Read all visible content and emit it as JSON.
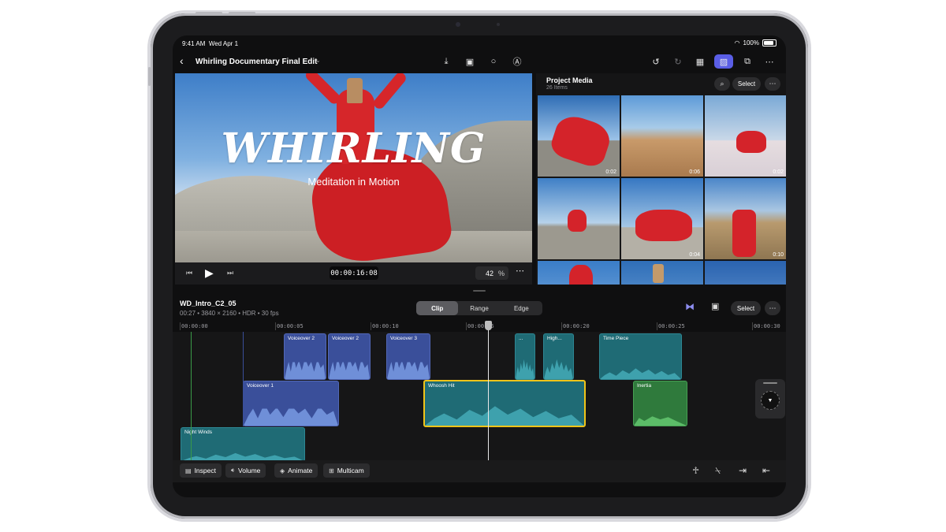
{
  "status": {
    "time": "9:41 AM",
    "date": "Wed Apr 1",
    "battery": "100%"
  },
  "toolbar": {
    "title": "Whirling Documentary Final Edit",
    "center_icons": [
      "import-icon",
      "camera-icon",
      "microphone-icon",
      "pencil-icon"
    ],
    "right_icons": [
      "undo-icon",
      "redo-icon",
      "inspector-icon",
      "media-browser-icon",
      "multicam-icon",
      "more-icon"
    ]
  },
  "viewer": {
    "title": "WHIRLING",
    "subtitle": "Meditation in Motion",
    "timecode": "00:00:16:08",
    "zoom_value": "42",
    "zoom_unit": "%"
  },
  "media": {
    "title": "Project Media",
    "count": "26 Items",
    "select_label": "Select",
    "thumbs": [
      {
        "duration": "0:02"
      },
      {
        "duration": "0:06"
      },
      {
        "duration": "0:02"
      },
      {
        "duration": ""
      },
      {
        "duration": "0:04"
      },
      {
        "duration": "0:10"
      },
      {
        "duration": ""
      },
      {
        "duration": ""
      },
      {
        "duration": ""
      }
    ]
  },
  "timeline": {
    "clip_name": "WD_Intro_C2_05",
    "clip_meta": "00:27 • 3840 × 2160 • HDR • 30 fps",
    "segments": [
      "Clip",
      "Range",
      "Edge"
    ],
    "active_segment": "Clip",
    "select_label": "Select",
    "ruler": [
      "00:00:00",
      "00:00:05",
      "00:00:10",
      "00:00:15",
      "00:00:20",
      "00:00:25",
      "00:00:30"
    ],
    "clips": {
      "vo2a": "Voiceover 2",
      "vo2b": "Voiceover 2",
      "vo3": "Voiceover 3",
      "small": "...",
      "high": "High...",
      "timepiece": "Time Piece",
      "vo1": "Voiceover 1",
      "whoosh": "Whoosh Hit",
      "inertia": "Inertia",
      "nightwinds": "Night Winds"
    }
  },
  "bottom": {
    "inspect": "Inspect",
    "volume": "Volume",
    "animate": "Animate",
    "multicam": "Multicam"
  },
  "colors": {
    "accent": "#5a5ee6",
    "voiceover": "#3a4f9a",
    "sfx": "#1f6b75",
    "music": "#2f7a3c",
    "selection": "#f0c419"
  }
}
